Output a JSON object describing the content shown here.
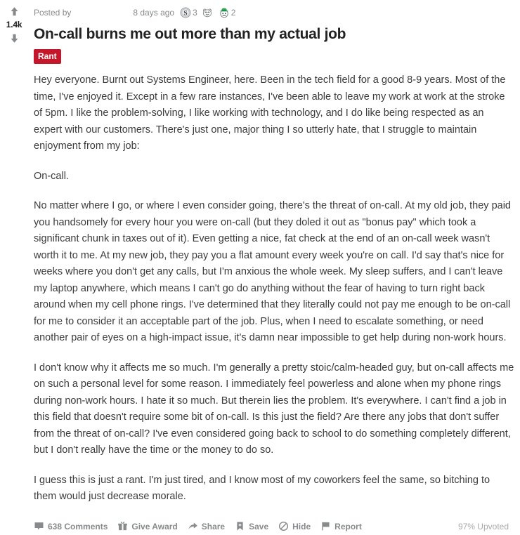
{
  "vote": {
    "upvote_icon": "arrow-up-icon",
    "score": "1.4k",
    "downvote_icon": "arrow-down-icon"
  },
  "meta": {
    "posted_by_label": "Posted by",
    "author": "",
    "timestamp": "8 days ago",
    "awards": [
      {
        "icon": "silver-award-icon",
        "name": "Silver",
        "count": "3"
      },
      {
        "icon": "hugz-award-icon",
        "name": "Hugz",
        "count": ""
      },
      {
        "icon": "lucky-award-icon",
        "name": "Lucky",
        "count": "2"
      }
    ]
  },
  "post": {
    "title": "On-call burns me out more than my actual job",
    "flair": "Rant",
    "paragraphs": [
      "Hey everyone. Burnt out Systems Engineer, here. Been in the tech field for a good 8-9 years. Most of the time, I've enjoyed it. Except in a few rare instances, I've been able to leave my work at work at the stroke of 5pm. I like the problem-solving, I like working with technology, and I do like being respected as an expert with our customers. There's just one, major thing I so utterly hate, that I struggle to maintain enjoyment from my job:",
      "On-call.",
      "No matter where I go, or where I even consider going, there's the threat of on-call. At my old job, they paid you handsomely for every hour you were on-call (but they doled it out as \"bonus pay\" which took a significant chunk in taxes out of it). Even getting a nice, fat check at the end of an on-call week wasn't worth it to me. At my new job, they pay you a flat amount every week you're on call. I'd say that's nice for weeks where you don't get any calls, but I'm anxious the whole week. My sleep suffers, and I can't leave my laptop anywhere, which means I can't go do anything without the fear of having to turn right back around when my cell phone rings. I've determined that they literally could not pay me enough to be on-call for me to consider it an acceptable part of the job. Plus, when I need to escalate something, or need another pair of eyes on a high-impact issue, it's damn near impossible to get help during non-work hours.",
      "I don't know why it affects me so much. I'm generally a pretty stoic/calm-headed guy, but on-call affects me on such a personal level for some reason. I immediately feel powerless and alone when my phone rings during non-work hours. I hate it so much. But therein lies the problem. It's everywhere. I can't find a job in this field that doesn't require some bit of on-call. Is this just the field? Are there any jobs that don't suffer from the threat of on-call? I've even considered going back to school to do something completely different, but I don't really have the time or the money to do so.",
      "I guess this is just a rant. I'm just tired, and I know most of my coworkers feel the same, so bitching to them would just decrease morale."
    ]
  },
  "actions": {
    "comments": "638 Comments",
    "give_award": "Give Award",
    "share": "Share",
    "save": "Save",
    "hide": "Hide",
    "report": "Report",
    "upvoted_percent": "97% Upvoted"
  },
  "colors": {
    "flair_bg": "#c4172c",
    "meta_text": "#878a8c",
    "body_text": "#3b3b3b",
    "title_text": "#222222"
  }
}
